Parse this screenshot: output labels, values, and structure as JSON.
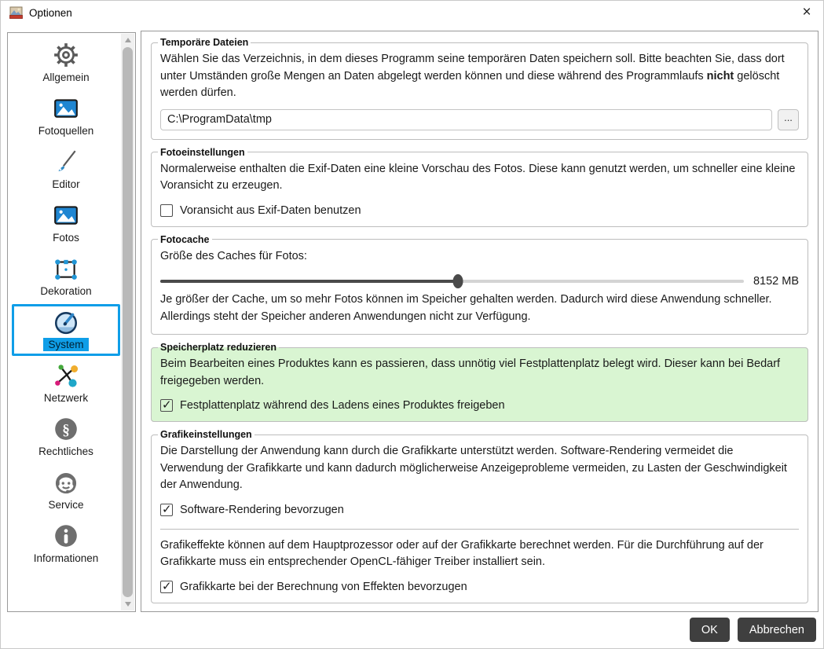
{
  "window": {
    "title": "Optionen",
    "close_glyph": "×"
  },
  "sidebar": {
    "items": [
      {
        "label": "Allgemein",
        "icon": "gear-icon",
        "selected": false
      },
      {
        "label": "Fotoquellen",
        "icon": "image-icon",
        "selected": false
      },
      {
        "label": "Editor",
        "icon": "brush-icon",
        "selected": false
      },
      {
        "label": "Fotos",
        "icon": "image-icon",
        "selected": false
      },
      {
        "label": "Dekoration",
        "icon": "selection-box-icon",
        "selected": false
      },
      {
        "label": "System",
        "icon": "gauge-icon",
        "selected": true
      },
      {
        "label": "Netzwerk",
        "icon": "network-icon",
        "selected": false
      },
      {
        "label": "Rechtliches",
        "icon": "paragraph-icon",
        "selected": false
      },
      {
        "label": "Service",
        "icon": "headset-icon",
        "selected": false
      },
      {
        "label": "Informationen",
        "icon": "info-icon",
        "selected": false
      }
    ]
  },
  "main": {
    "temp_files": {
      "legend": "Temporäre Dateien",
      "desc_before_bold": "Wählen Sie das Verzeichnis, in dem dieses Programm seine temporären Daten speichern soll. Bitte beachten Sie, dass dort unter Umständen große Mengen an Daten abgelegt werden können und diese während des Programmlaufs ",
      "desc_bold": "nicht",
      "desc_after_bold": " gelöscht werden dürfen.",
      "path_value": "C:\\ProgramData\\tmp",
      "browse_label": "..."
    },
    "photo_settings": {
      "legend": "Fotoeinstellungen",
      "desc": "Normalerweise enthalten die Exif-Daten eine kleine Vorschau des Fotos. Diese kann genutzt werden, um schneller eine kleine Voransicht zu erzeugen.",
      "checkbox_label": "Voransicht aus Exif-Daten benutzen",
      "checkbox_checked": false
    },
    "photo_cache": {
      "legend": "Fotocache",
      "slider_label": "Größe des Caches für Fotos:",
      "slider_value": "8152 MB",
      "slider_percent": 51,
      "desc": "Je größer der Cache, um so mehr Fotos können im Speicher gehalten werden. Dadurch wird diese Anwendung schneller. Allerdings steht der Speicher anderen Anwendungen nicht zur Verfügung."
    },
    "reduce_space": {
      "legend": "Speicherplatz reduzieren",
      "desc": "Beim Bearbeiten eines Produktes kann es passieren, dass unnötig viel Festplattenplatz belegt wird. Dieser kann bei Bedarf freigegeben werden.",
      "checkbox_label": "Festplattenplatz während des Ladens eines Produktes freigeben",
      "checkbox_checked": true,
      "highlight_color": "#d9f5d2"
    },
    "graphics": {
      "legend": "Grafikeinstellungen",
      "desc_1": "Die Darstellung der Anwendung kann durch die Grafikkarte unterstützt werden. Software-Rendering vermeidet die Verwendung der Grafikkarte und kann dadurch möglicherweise Anzeigeprobleme vermeiden, zu Lasten der Geschwindigkeit der Anwendung.",
      "checkbox1_label": "Software-Rendering bevorzugen",
      "checkbox1_checked": true,
      "desc_2": "Grafikeffekte können auf dem Hauptprozessor oder auf der Grafikkarte berechnet werden. Für die Durchführung auf der Grafikkarte muss ein entsprechender OpenCL-fähiger Treiber installiert sein.",
      "checkbox2_label": "Grafikkarte bei der Berechnung von Effekten bevorzugen",
      "checkbox2_checked": true
    }
  },
  "footer": {
    "ok_label": "OK",
    "cancel_label": "Abbrechen"
  },
  "colors": {
    "accent_blue": "#0f9ee8",
    "highlight_green": "#d9f5d2",
    "button_dark": "#3f3f3f",
    "slider_dark": "#4a4a4a"
  }
}
